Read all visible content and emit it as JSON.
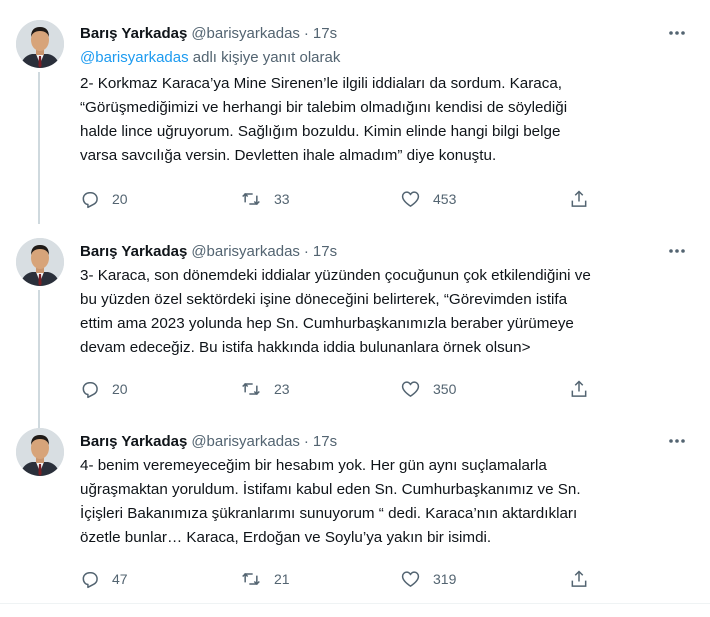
{
  "tweets": [
    {
      "name": "Barış Yarkadaş",
      "handle": "@barisyarkadas",
      "sep": "·",
      "time": "17s",
      "replying_mention": "@barisyarkadas",
      "replying_rest": " adlı kişiye yanıt olarak",
      "lines": [
        "2- Korkmaz Karaca’ya Mine Sirenen’le ilgili iddiaları da sordum. Karaca,",
        "“Görüşmediğimizi ve herhangi bir talebim olmadığını kendisi de söylediği",
        "halde lince uğruyorum. Sağlığım bozuldu. Kimin elinde hangi bilgi belge",
        "varsa savcılığa versin. Devletten ihale almadım” diye konuştu."
      ],
      "replies": "20",
      "retweets": "33",
      "likes": "453"
    },
    {
      "name": "Barış Yarkadaş",
      "handle": "@barisyarkadas",
      "sep": "·",
      "time": "17s",
      "lines": [
        "3- Karaca, son dönemdeki iddialar yüzünden çocuğunun çok etkilendiğini ve",
        "bu yüzden özel sektördeki işine döneceğini belirterek, “Görevimden istifa",
        "ettim ama 2023 yolunda hep Sn. Cumhurbaşkanımızla beraber yürümeye",
        "devam edeceğiz. Bu istifa hakkında iddia bulunanlara örnek olsun>"
      ],
      "replies": "20",
      "retweets": "23",
      "likes": "350"
    },
    {
      "name": "Barış Yarkadaş",
      "handle": "@barisyarkadas",
      "sep": "·",
      "time": "17s",
      "lines": [
        "4- benim veremeyeceğim bir hesabım yok. Her gün aynı suçlamalarla",
        "uğraşmaktan yoruldum. İstifamı kabul eden Sn. Cumhurbaşkanımız ve Sn.",
        "İçişleri Bakanımıza şükranlarımı sunuyorum “ dedi. Karaca’nın aktardıkları",
        "özetle bunlar… Karaca, Erdoğan ve Soylu’ya yakın bir isimdi."
      ],
      "replies": "47",
      "retweets": "21",
      "likes": "319"
    }
  ],
  "icons": {
    "reply": "reply-icon",
    "retweet": "retweet-icon",
    "like": "heart-icon",
    "share": "share-icon",
    "more": "more-icon"
  },
  "colors": {
    "text": "#0f1419",
    "secondary": "#536471",
    "link": "#1d9bf0",
    "thread_line": "#cfd9de",
    "divider": "#eff3f4"
  }
}
